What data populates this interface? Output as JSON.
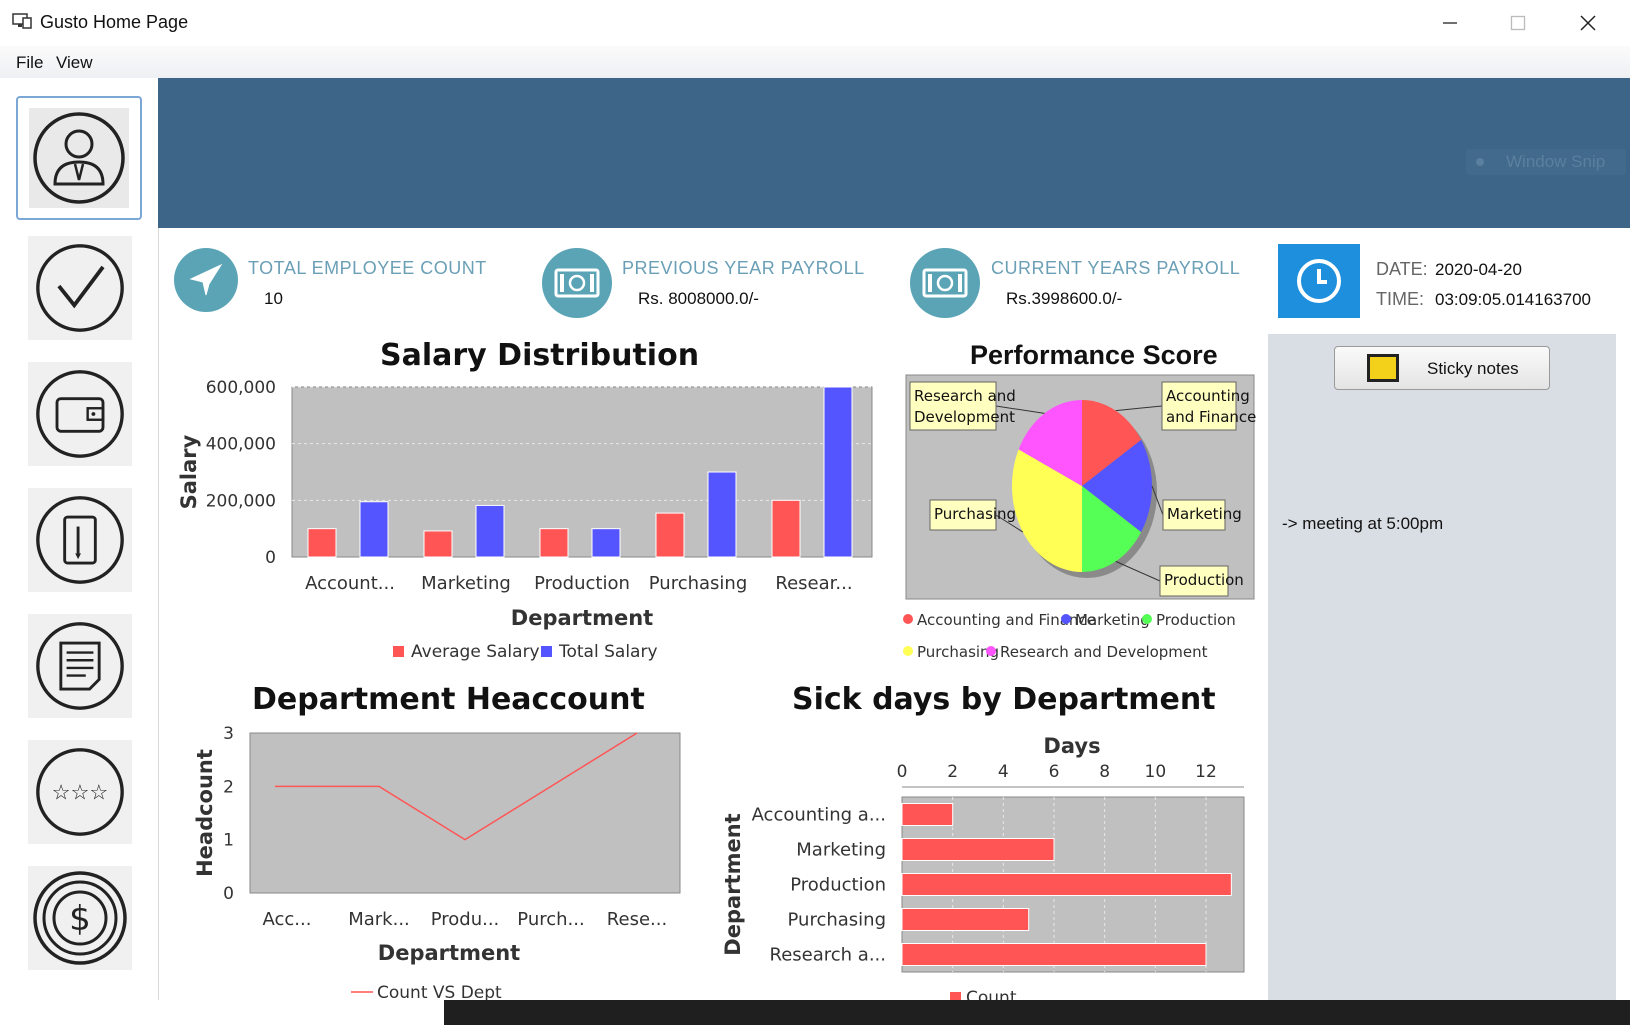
{
  "window": {
    "title": "Gusto Home Page"
  },
  "menu": {
    "items": [
      "File",
      "View"
    ]
  },
  "sidebar": {
    "icons": [
      "employee-icon",
      "checkmark-icon",
      "wallet-icon",
      "clipboard-icon",
      "document-icon",
      "rating-stars-icon",
      "dollar-icon"
    ]
  },
  "overlay": {
    "window_snip": "Window Snip"
  },
  "kpis": [
    {
      "label": "TOTAL EMPLOYEE COUNT",
      "value": "10",
      "icon": "airplane-icon"
    },
    {
      "label": "PREVIOUS YEAR PAYROLL",
      "value": "Rs. 8008000.0/-",
      "icon": "banknote-icon"
    },
    {
      "label": "CURRENT YEARS PAYROLL",
      "value": "Rs.3998600.0/-",
      "icon": "banknote-icon"
    }
  ],
  "datetime": {
    "date_label": "DATE:",
    "date_value": "2020-04-20",
    "time_label": "TIME:",
    "time_value": "03:09:05.014163700"
  },
  "notes": {
    "sticky_label": "Sticky notes",
    "note_text": "-> meeting at 5:00pm"
  },
  "colors": {
    "banner": "#3d6587",
    "kpi_icon": "#5aa4b6",
    "clock": "#1e8fdc",
    "red_series": "#ff5555",
    "blue_series": "#5555ff",
    "plot_bg": "#c0c0c0"
  },
  "chart_data": [
    {
      "type": "bar",
      "title": "Salary Distribution",
      "xlabel": "Department",
      "ylabel": "Salary",
      "categories": [
        "Account...",
        "Marketing",
        "Production",
        "Purchasing",
        "Resear..."
      ],
      "yticks": [
        "0",
        "200,000",
        "400,000",
        "600,000"
      ],
      "ylim": [
        0,
        600000
      ],
      "series": [
        {
          "name": "Average Salary",
          "values": [
            100000,
            92000,
            100000,
            155000,
            200000
          ]
        },
        {
          "name": "Total Salary",
          "values": [
            195000,
            182000,
            100000,
            300000,
            600000
          ]
        }
      ],
      "grid": true,
      "legend": "bottom"
    },
    {
      "type": "pie",
      "title": "Performance Score",
      "labels": [
        "Accounting and Finance",
        "Marketing",
        "Production",
        "Purchasing",
        "Research and Development"
      ],
      "callouts": [
        "Accounting\nand Finance",
        "Marketing",
        "Production",
        "Purchasing",
        "Research and\nDevelopment"
      ],
      "values": [
        16,
        18,
        16,
        32,
        18
      ],
      "colors": [
        "#ff5555",
        "#5555ff",
        "#55ff55",
        "#ffff55",
        "#ff55ff"
      ],
      "legend": "bottom"
    },
    {
      "type": "line",
      "title": "Department Heaccount",
      "xlabel": "Department",
      "ylabel": "Headcount",
      "categories": [
        "Acc...",
        "Mark...",
        "Produ...",
        "Purch...",
        "Rese..."
      ],
      "yticks": [
        "0",
        "1",
        "2",
        "3"
      ],
      "ylim": [
        0,
        3
      ],
      "series": [
        {
          "name": "Count VS Dept",
          "values": [
            2,
            2,
            1,
            2,
            3
          ]
        }
      ],
      "legend": "bottom"
    },
    {
      "type": "bar",
      "orientation": "horizontal",
      "title": "Sick days by Department",
      "xlabel": "Days",
      "ylabel": "Department",
      "categories": [
        "Accounting a...",
        "Marketing",
        "Production",
        "Purchasing",
        "Research a..."
      ],
      "xticks": [
        "0",
        "2",
        "4",
        "6",
        "8",
        "10",
        "12"
      ],
      "xlim": [
        0,
        13.5
      ],
      "series": [
        {
          "name": "Count",
          "values": [
            2,
            6,
            13,
            5,
            12
          ]
        }
      ],
      "grid": true,
      "legend": "bottom"
    }
  ]
}
